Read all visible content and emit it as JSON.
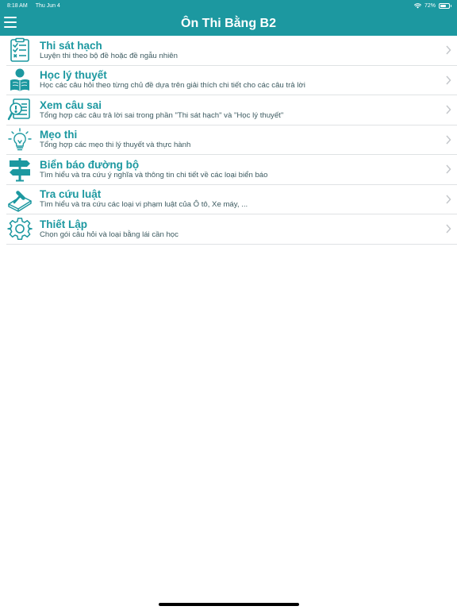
{
  "status_bar": {
    "time": "8:18 AM",
    "date": "Thu Jun 4",
    "battery": "72%",
    "battery_level": 0.72
  },
  "nav": {
    "title": "Ôn Thi Bằng B2",
    "menu_icon": "hamburger-menu-icon"
  },
  "colors": {
    "accent": "#1c98a0",
    "subtitle": "#3c5a60",
    "divider": "#dfe2e4",
    "chevron": "#c4c7cb"
  },
  "menu": [
    {
      "icon": "checklist-icon",
      "title": "Thi sát hạch",
      "subtitle": "Luyện thi theo bộ đề hoặc đề ngẫu nhiên"
    },
    {
      "icon": "student-reading-icon",
      "title": "Học lý thuyết",
      "subtitle": "Học các câu hỏi theo từng chủ đề dựa trên giải thích chi tiết cho các câu trả lời"
    },
    {
      "icon": "document-alert-icon",
      "title": "Xem câu sai",
      "subtitle": "Tổng hợp các câu trả lời sai trong phần \"Thi sát hạch\" và \"Học lý thuyết\""
    },
    {
      "icon": "lightbulb-icon",
      "title": "Mẹo thi",
      "subtitle": "Tổng hợp các mẹo thi lý thuyết và thực hành"
    },
    {
      "icon": "signpost-icon",
      "title": "Biển báo đường bộ",
      "subtitle": "Tìm hiểu và tra cứu ý nghĩa và thông tin chi tiết về các loại biển báo"
    },
    {
      "icon": "law-book-icon",
      "title": "Tra cứu luật",
      "subtitle": "Tìm hiểu và tra cứu các loại vi phạm luật của Ô tô, Xe máy, ..."
    },
    {
      "icon": "gear-icon",
      "title": "Thiết Lập",
      "subtitle": "Chọn gói câu hỏi và loại bằng lái cần học"
    }
  ]
}
